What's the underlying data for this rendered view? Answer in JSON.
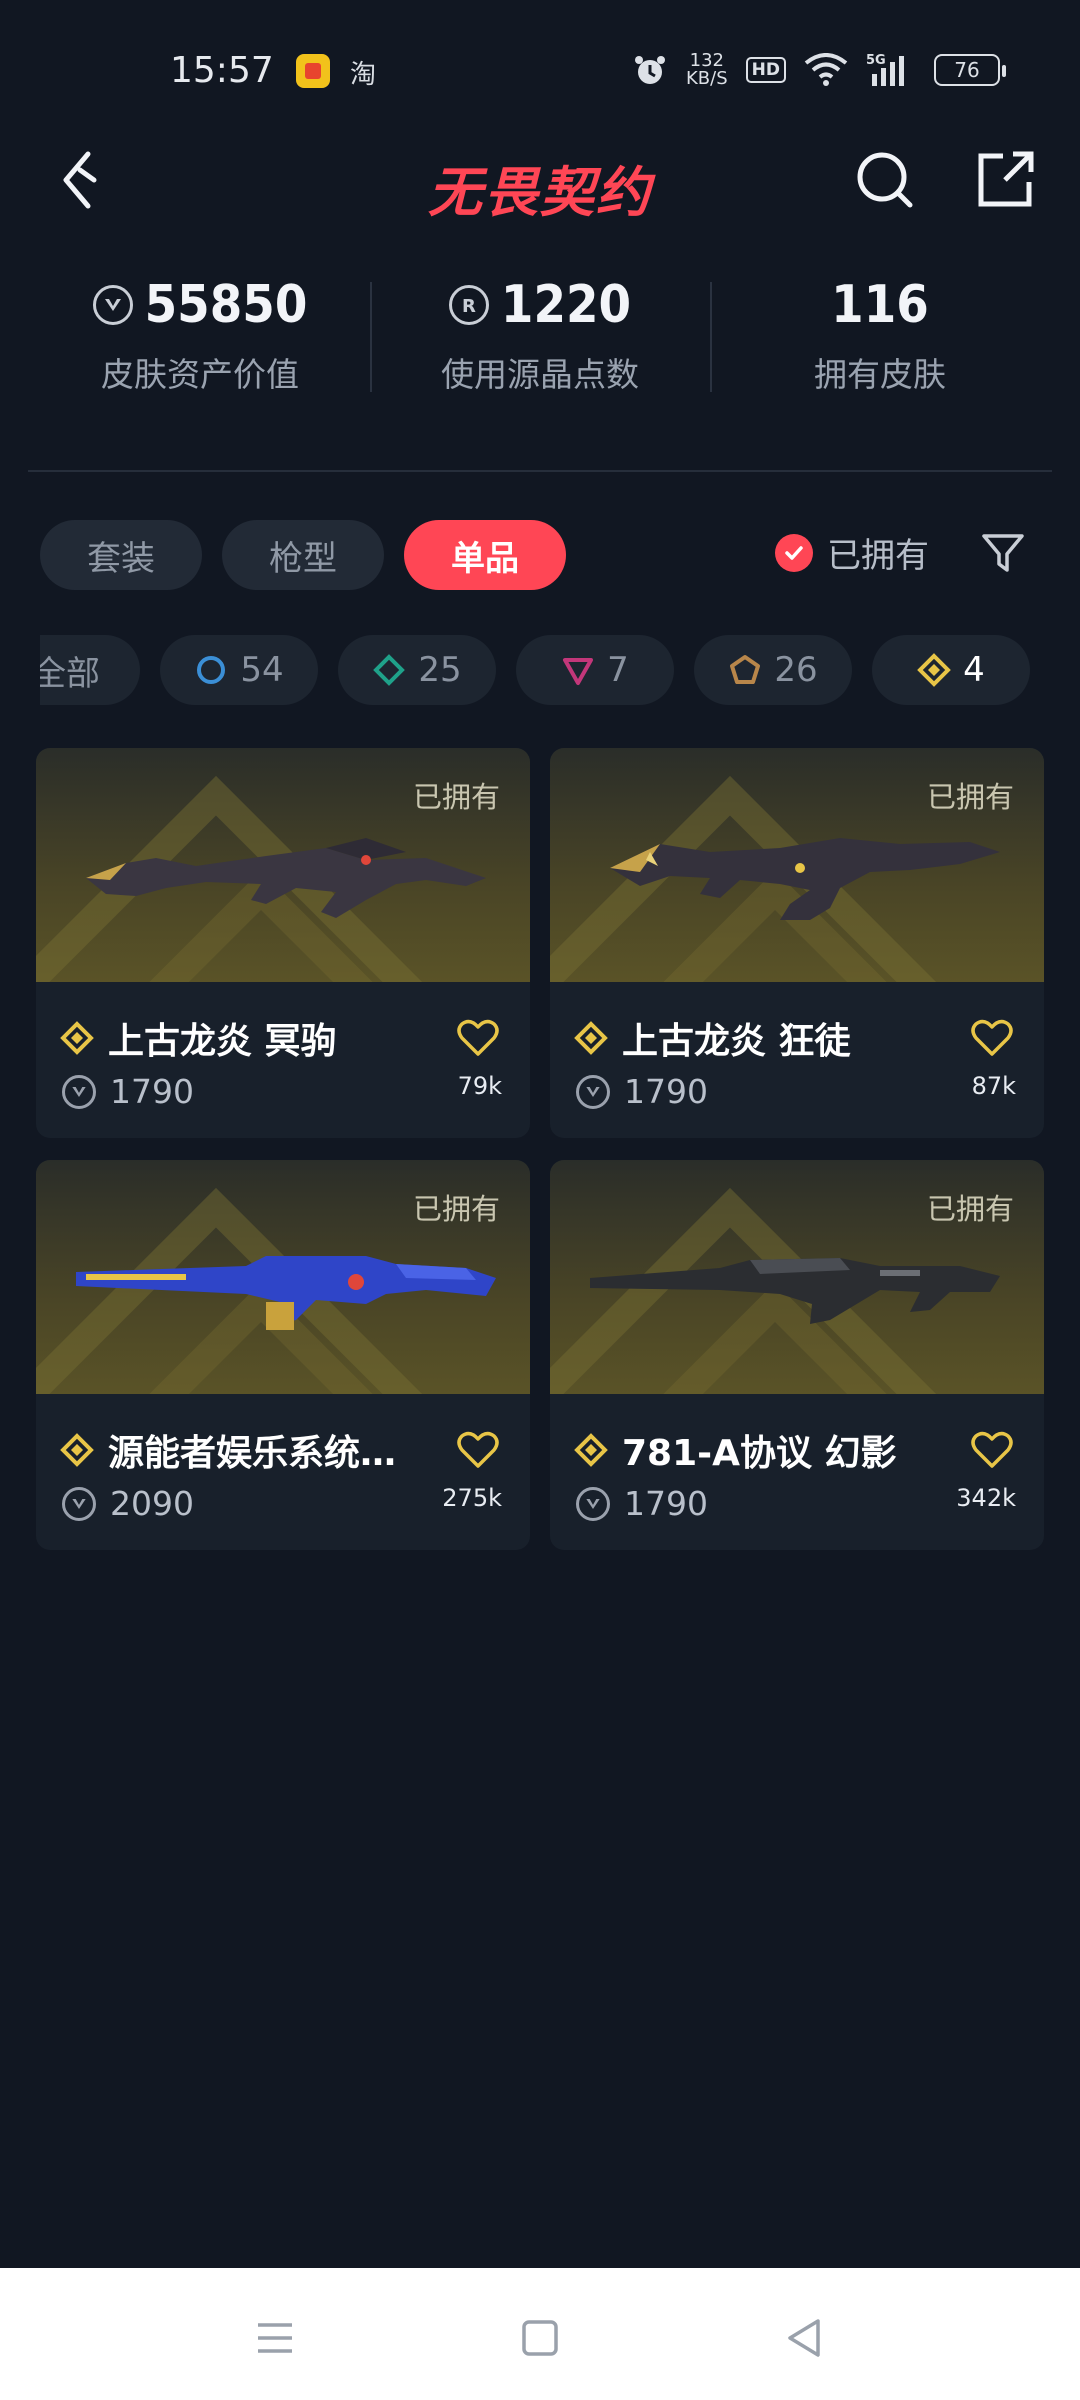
{
  "status_bar": {
    "time": "15:57",
    "taobao": "淘",
    "net_speed_top": "132",
    "net_speed_bottom": "KB/S",
    "hd": "HD",
    "battery": "76"
  },
  "header": {
    "title": "无畏契约"
  },
  "stats": [
    {
      "value": "55850",
      "label": "皮肤资产价值",
      "icon": "vp-icon"
    },
    {
      "value": "1220",
      "label": "使用源晶点数",
      "icon": "radianite-icon"
    },
    {
      "value": "116",
      "label": "拥有皮肤",
      "icon": ""
    }
  ],
  "tabs": [
    {
      "label": "套装",
      "active": false
    },
    {
      "label": "枪型",
      "active": false
    },
    {
      "label": "单品",
      "active": true
    }
  ],
  "owned_filter": {
    "label": "已拥有",
    "checked": true
  },
  "chips": [
    {
      "label": "全部",
      "count": ""
    },
    {
      "label": "",
      "count": "54",
      "tier": "select",
      "color": "#3b8fd6"
    },
    {
      "label": "",
      "count": "25",
      "tier": "deluxe",
      "color": "#1fa28a"
    },
    {
      "label": "",
      "count": "7",
      "tier": "premium",
      "color": "#c3377a"
    },
    {
      "label": "",
      "count": "26",
      "tier": "ultra",
      "color": "#b8864a"
    },
    {
      "label": "",
      "count": "4",
      "tier": "exclusive",
      "color": "#e8c547"
    }
  ],
  "cards": [
    {
      "owned": "已拥有",
      "name": "上古龙炎 冥驹",
      "price": "1790",
      "likes": "79k",
      "weapon": "dragon-sniper"
    },
    {
      "owned": "已拥有",
      "name": "上古龙炎 狂徒",
      "price": "1790",
      "likes": "87k",
      "weapon": "dragon-rifle"
    },
    {
      "owned": "已拥有",
      "name": "源能者娱乐系统…",
      "price": "2090",
      "likes": "275k",
      "weapon": "blue-rifle"
    },
    {
      "owned": "已拥有",
      "name": "781-A协议 幻影",
      "price": "1790",
      "likes": "342k",
      "weapon": "black-rifle"
    }
  ],
  "colors": {
    "background": "#111722",
    "accent": "#ff4655",
    "card": "#18202b",
    "gold": "#e8c547"
  }
}
